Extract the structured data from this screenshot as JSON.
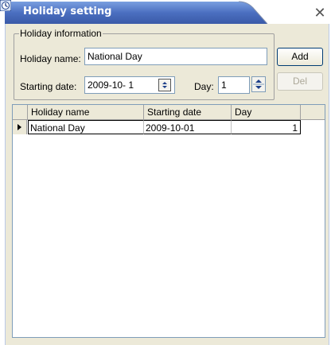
{
  "window": {
    "title": "Holiday setting",
    "close_glyph": "✕",
    "accent_color": "#4b6fc0"
  },
  "holiday_info": {
    "group_label": "Holiday information",
    "name_label": "Holiday name:",
    "name_value": "National Day",
    "start_label": "Starting date:",
    "start_value": "2009-10- 1",
    "day_label": "Day:",
    "day_value": "1"
  },
  "buttons": {
    "add_label": "Add",
    "del_label": "Del"
  },
  "grid": {
    "columns": [
      "Holiday name",
      "Starting date",
      "Day"
    ],
    "rows": [
      {
        "name": "National Day",
        "start": "2009-10-01",
        "day": "1"
      }
    ]
  }
}
